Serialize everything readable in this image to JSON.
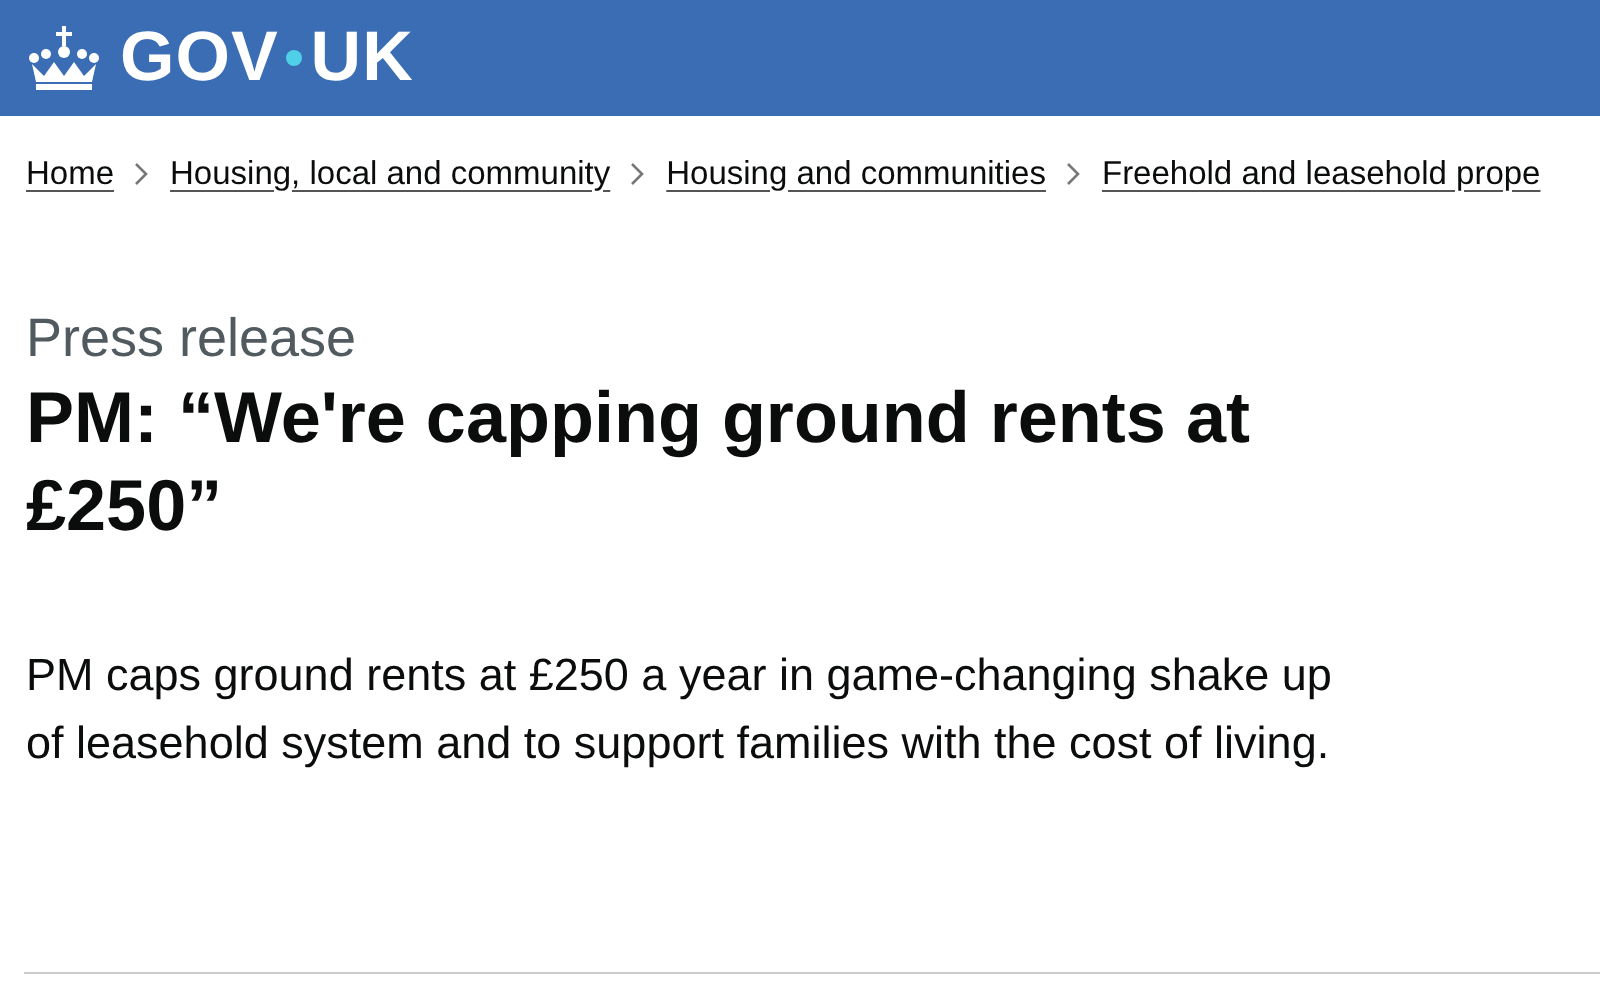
{
  "header": {
    "logo": [
      "GOV",
      "UK"
    ]
  },
  "breadcrumbs": [
    "Home",
    "Housing, local and community",
    "Housing and communities",
    "Freehold and leasehold prope"
  ],
  "caption": "Press release",
  "title": "PM: “We're capping ground rents at £250”",
  "lead": "PM caps ground rents at £250 a year in game-changing shake up of leasehold system and to support families with the cost of living."
}
